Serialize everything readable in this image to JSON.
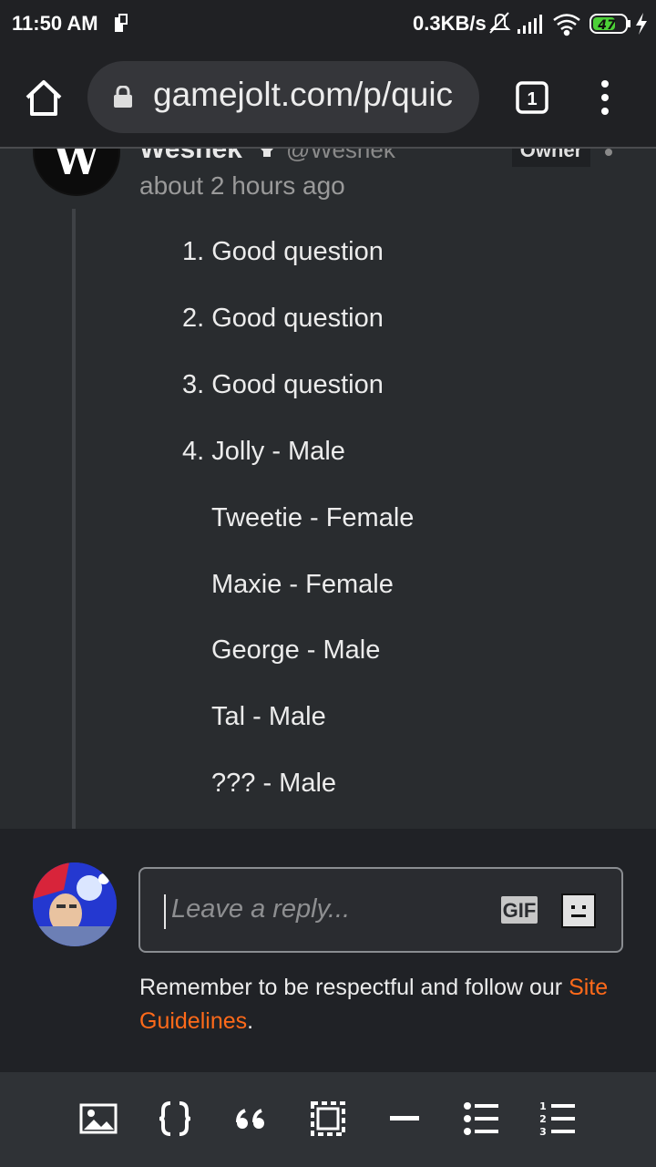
{
  "status_bar": {
    "time": "11:50 AM",
    "net_speed": "0.3KB/s",
    "battery": "47",
    "icons": [
      "sim-icon",
      "bell-muted-icon",
      "signal-icon",
      "wifi-icon",
      "battery-icon",
      "charging-icon"
    ]
  },
  "browser": {
    "url": "gamejolt.com/p/quic",
    "tab_count": "1"
  },
  "comment": {
    "author_name": "Wesnek",
    "author_handle": "@Wesnek",
    "owner_tag": "Owner",
    "avatar_letter": "W",
    "timestamp": "about 2 hours ago",
    "lines": [
      "1. Good question",
      "2. Good question",
      "3. Good question",
      "4. Jolly - Male",
      "Tweetie - Female",
      "Maxie - Female",
      "George - Male",
      "Tal - Male",
      "??? - Male"
    ]
  },
  "composer": {
    "placeholder": "Leave a reply...",
    "gif_label": "GIF",
    "guidelines_text": "Remember to be respectful and follow our ",
    "guidelines_link": "Site Guidelines",
    "guidelines_end": "."
  },
  "toolbar": {
    "buttons": [
      "image-icon",
      "code-icon",
      "quote-icon",
      "spoiler-icon",
      "horizontal-rule-icon",
      "bullet-list-icon",
      "numbered-list-icon"
    ]
  },
  "colors": {
    "link": "#ff6a1a",
    "background": "#292c2f"
  }
}
